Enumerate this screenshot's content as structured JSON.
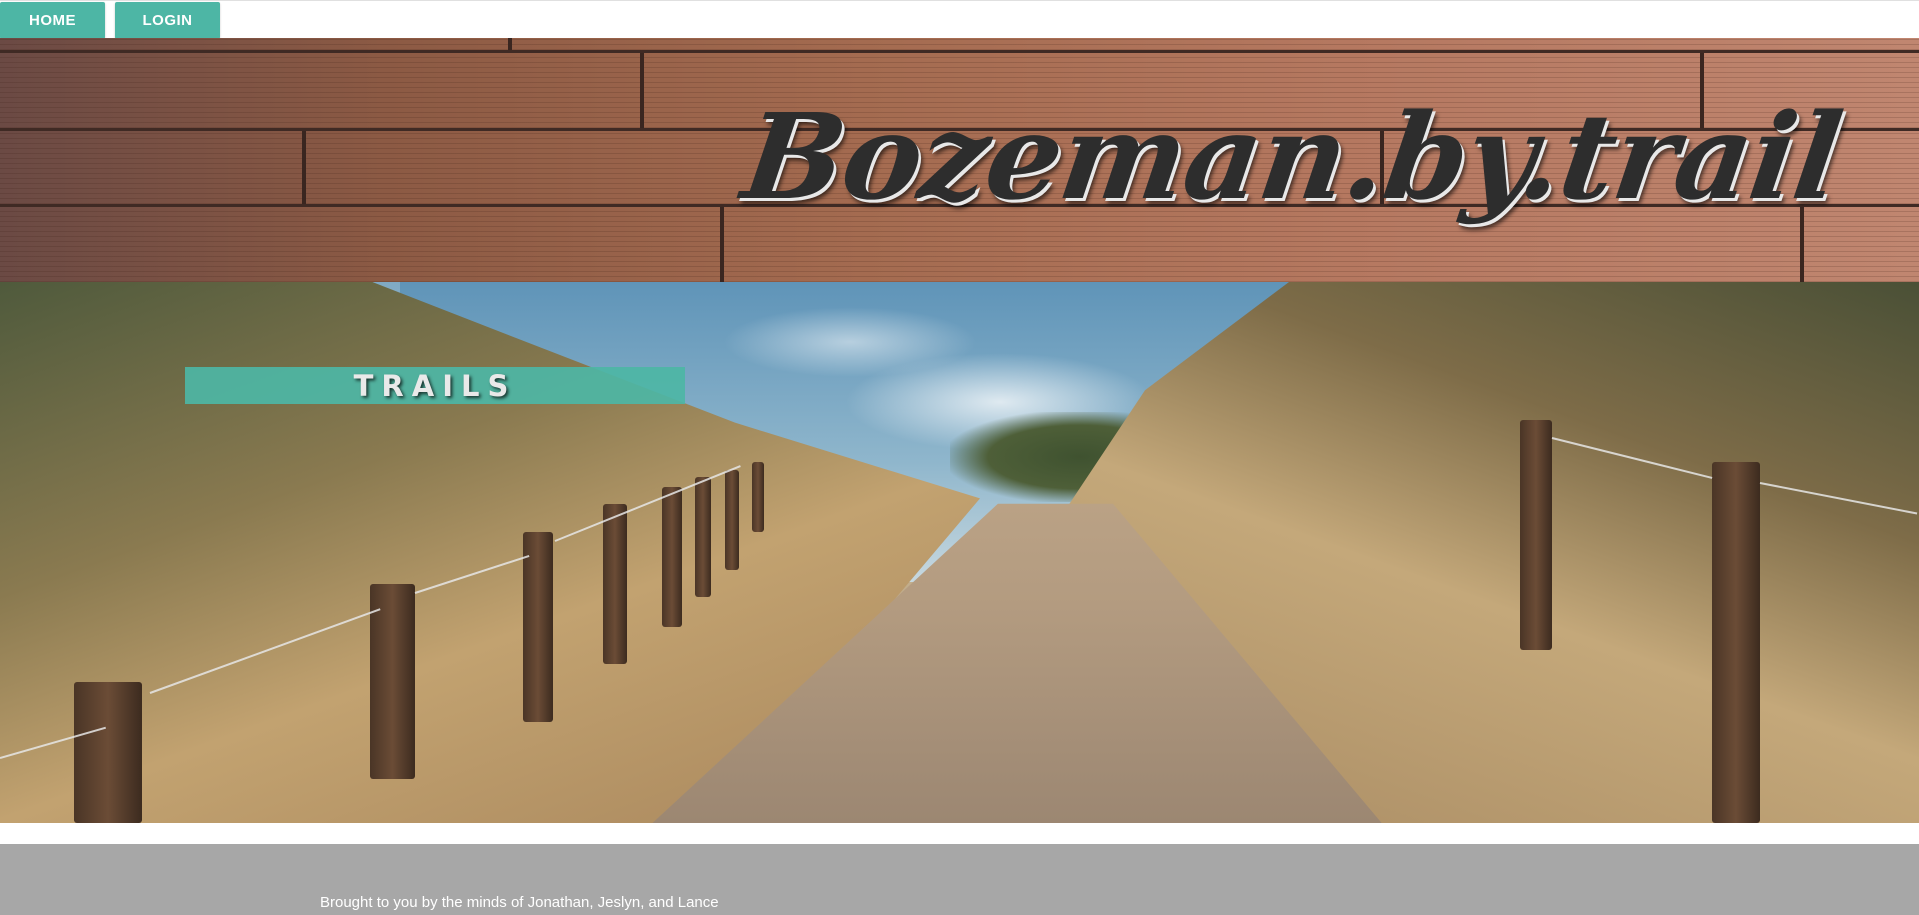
{
  "nav": {
    "home_label": "HOME",
    "login_label": "LOGIN"
  },
  "header": {
    "brand_title": "Bozeman.by.trail"
  },
  "hero": {
    "trails_label": "TRAILS"
  },
  "footer": {
    "credits": "Brought to you by the minds of Jonathan, Jeslyn, and Lance"
  },
  "colors": {
    "accent": "#4db6a5",
    "footer_bg": "#a7a7a7"
  }
}
